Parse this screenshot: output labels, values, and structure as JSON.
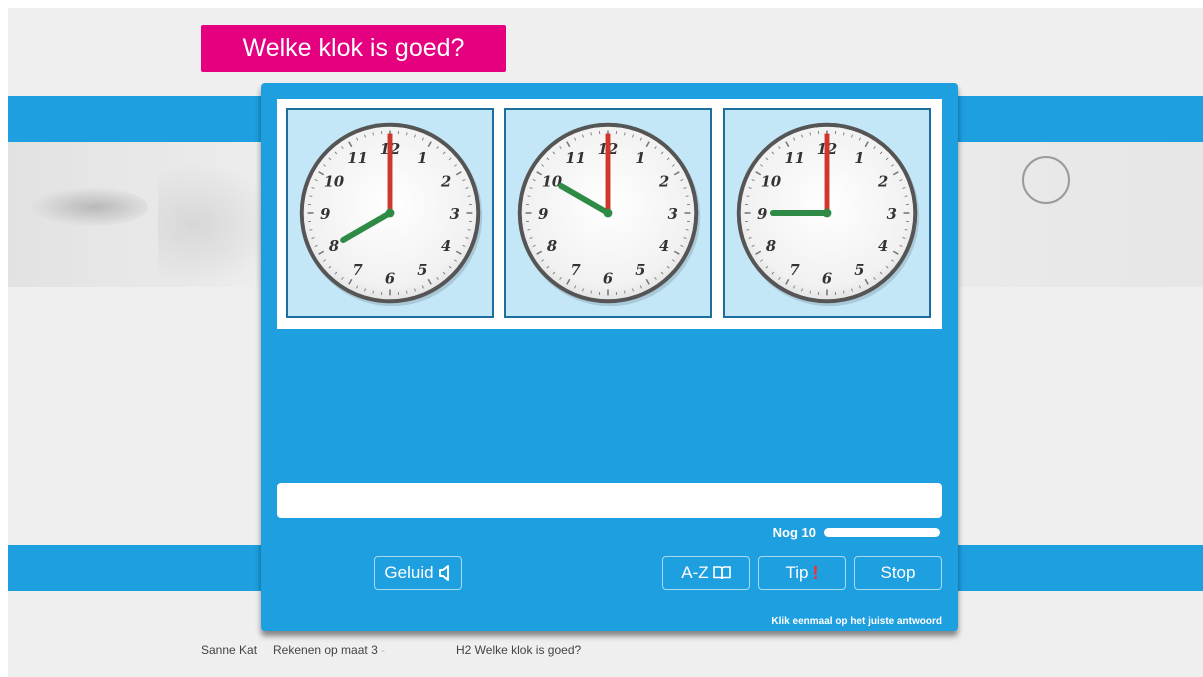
{
  "title": "Welke klok is goed?",
  "clocks": [
    {
      "hour": 8,
      "minute": 0
    },
    {
      "hour": 10,
      "minute": 0
    },
    {
      "hour": 9,
      "minute": 0
    }
  ],
  "clock_numbers": [
    "12",
    "1",
    "2",
    "3",
    "4",
    "5",
    "6",
    "7",
    "8",
    "9",
    "10",
    "11"
  ],
  "answer": {
    "value": ""
  },
  "counter": {
    "label": "Nog 10",
    "progress": 1.0
  },
  "buttons": {
    "sound": "Geluid",
    "dictionary": "A-Z",
    "tip": "Tip",
    "tip_mark": "!",
    "stop": "Stop"
  },
  "hint": "Klik eenmaal op het juiste antwoord",
  "footer": {
    "student": "Sanne Kat",
    "course": "Rekenen op maat 3",
    "course_suffix": "-",
    "lesson": "H2 Welke klok is goed?"
  },
  "colors": {
    "accent_blue": "#1e9fe0",
    "title_pink": "#e4007f",
    "minute_hand": "#d1362b",
    "hour_hand": "#2e8b45",
    "tip_mark": "#ff2a2a"
  }
}
